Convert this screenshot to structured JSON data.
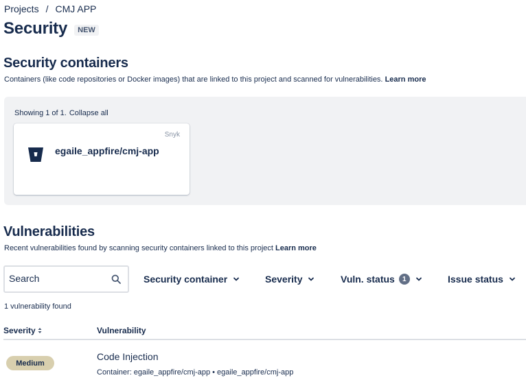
{
  "breadcrumb": {
    "items": [
      "Projects",
      "CMJ APP"
    ],
    "separator": "/"
  },
  "page": {
    "title": "Security",
    "badge": "NEW"
  },
  "containers_section": {
    "title": "Security containers",
    "description": "Containers (like code repositories or Docker images) that are linked to this project and scanned for vulnerabilities.",
    "learn_more": "Learn more",
    "showing": "Showing 1 of 1.",
    "collapse_all": "Collapse all",
    "cards": [
      {
        "provider": "Snyk",
        "name": "egaile_appfire/cmj-app",
        "icon": "bitbucket-icon"
      }
    ]
  },
  "vulnerabilities_section": {
    "title": "Vulnerabilities",
    "description": "Recent vulnerabilities found by scanning security containers linked to this project",
    "learn_more": "Learn more",
    "search": {
      "placeholder": "Search",
      "value": ""
    },
    "filters": {
      "security_container": "Security container",
      "severity": "Severity",
      "vuln_status": "Vuln. status",
      "vuln_status_count": "1",
      "issue_status": "Issue status"
    },
    "count_text": "1 vulnerability found",
    "columns": {
      "severity": "Severity",
      "vulnerability": "Vulnerability"
    },
    "rows": [
      {
        "severity": "Medium",
        "name": "Code Injection",
        "meta": "Container: egaile_appfire/cmj-app • egaile_appfire/cmj-app"
      }
    ]
  },
  "colors": {
    "medium_severity": "#d8cfae",
    "panel_bg": "#f1f2f4",
    "text": "#172b4d"
  }
}
